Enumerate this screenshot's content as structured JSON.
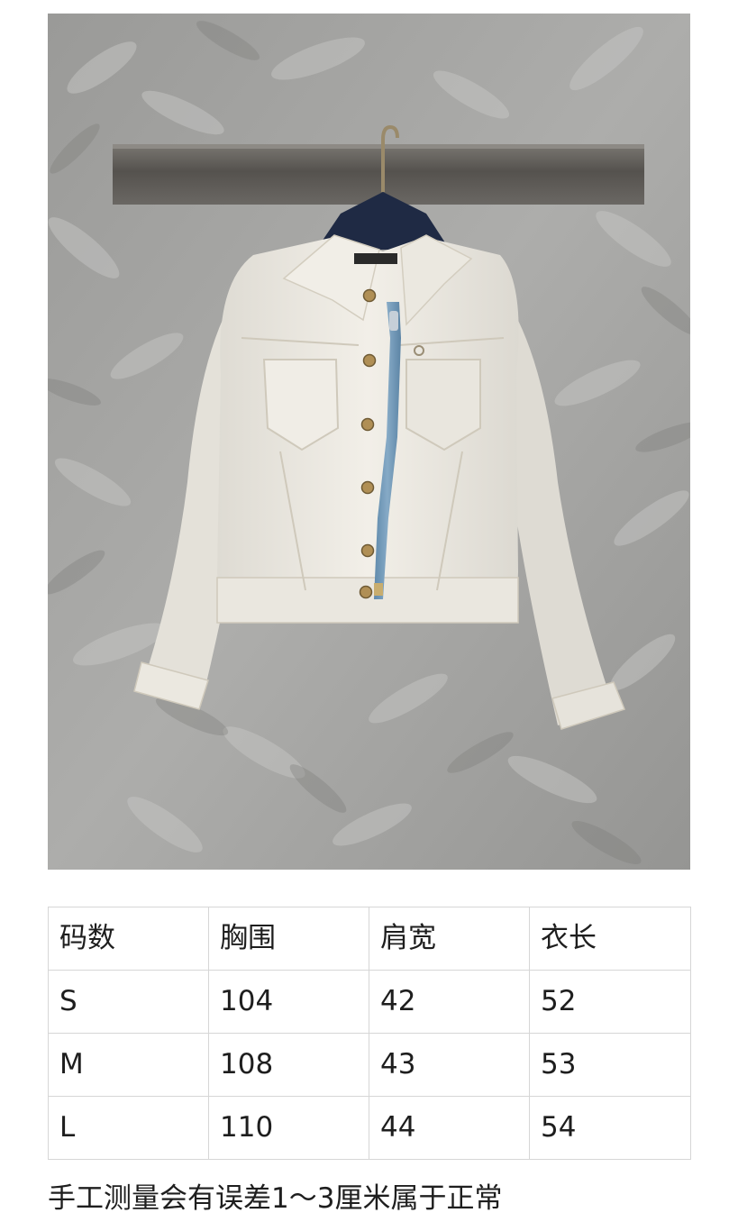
{
  "product_photo": {
    "icon": "white-denim-jacket-on-hanger-image",
    "colors": {
      "wallpaper": "#a3a3a1",
      "rail": "#5e5b57",
      "jacket": "#ece9e2",
      "zip_tape": "#6f97b8",
      "button": "#a98a52"
    }
  },
  "size_table": {
    "headers": [
      "码数",
      "胸围",
      "肩宽",
      "衣长"
    ],
    "rows": [
      [
        "S",
        "104",
        "42",
        "52"
      ],
      [
        "M",
        "108",
        "43",
        "53"
      ],
      [
        "L",
        "110",
        "44",
        "54"
      ]
    ]
  },
  "note": "手工测量会有误差1～3厘米属于正常"
}
